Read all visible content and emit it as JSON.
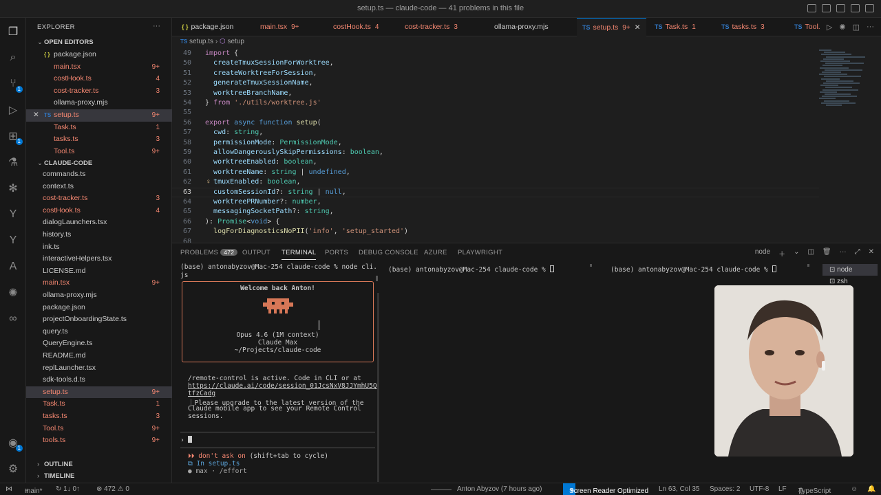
{
  "window": {
    "title": "setup.ts — claude-code — 41 problems in this file"
  },
  "activity": [
    {
      "name": "files-icon",
      "glyph": "❐"
    },
    {
      "name": "search-icon",
      "glyph": "⌕"
    },
    {
      "name": "source-control-icon",
      "glyph": "⑂",
      "badge": "1"
    },
    {
      "name": "run-debug-icon",
      "glyph": "▷"
    },
    {
      "name": "extensions-icon",
      "glyph": "⊞",
      "badge": "1"
    },
    {
      "name": "testing-icon",
      "glyph": "⚗"
    },
    {
      "name": "openai-icon",
      "glyph": "✻"
    },
    {
      "name": "github-icon",
      "glyph": "Y"
    },
    {
      "name": "git-graph-icon",
      "glyph": "Y"
    },
    {
      "name": "anthropic-icon",
      "glyph": "A"
    },
    {
      "name": "chatgpt-icon",
      "glyph": "✺"
    },
    {
      "name": "infinity-icon",
      "glyph": "∞"
    },
    {
      "name": "accounts-icon",
      "glyph": "◉",
      "badge": "1"
    },
    {
      "name": "settings-gear-icon",
      "glyph": "⚙"
    }
  ],
  "sidebar": {
    "header": "EXPLORER",
    "more": "···",
    "open_editors_label": "OPEN EDITORS",
    "open_editors": [
      {
        "icon": "{ }",
        "name": "package.json",
        "count": "",
        "style": "c-json",
        "ico": "ico-json"
      },
      {
        "icon": "",
        "name": "main.tsx",
        "count": "9+",
        "style": "c-err",
        "ico": "ico-react"
      },
      {
        "icon": "",
        "name": "costHook.ts",
        "count": "4",
        "style": "c-err",
        "ico": "ico-ts"
      },
      {
        "icon": "",
        "name": "cost-tracker.ts",
        "count": "3",
        "style": "c-err",
        "ico": "ico-ts"
      },
      {
        "icon": "",
        "name": "ollama-proxy.mjs",
        "count": "",
        "style": "c-plain",
        "ico": "ico-json"
      },
      {
        "icon": "TS",
        "name": "setup.ts",
        "count": "9+",
        "style": "c-err",
        "ico": "ico-ts",
        "selected": true,
        "close": "✕"
      },
      {
        "icon": "",
        "name": "Task.ts",
        "count": "1",
        "style": "c-err",
        "ico": "ico-ts"
      },
      {
        "icon": "",
        "name": "tasks.ts",
        "count": "3",
        "style": "c-err",
        "ico": "ico-ts"
      },
      {
        "icon": "",
        "name": "Tool.ts",
        "count": "9+",
        "style": "c-err",
        "ico": "ico-ts"
      }
    ],
    "project_label": "CLAUDE-CODE",
    "files": [
      {
        "name": "commands.ts",
        "count": "",
        "style": "c-plain"
      },
      {
        "name": "context.ts",
        "count": "",
        "style": "c-plain"
      },
      {
        "name": "cost-tracker.ts",
        "count": "3",
        "style": "c-err"
      },
      {
        "name": "costHook.ts",
        "count": "4",
        "style": "c-err"
      },
      {
        "name": "dialogLaunchers.tsx",
        "count": "",
        "style": "c-plain"
      },
      {
        "name": "history.ts",
        "count": "",
        "style": "c-plain"
      },
      {
        "name": "ink.ts",
        "count": "",
        "style": "c-plain"
      },
      {
        "name": "interactiveHelpers.tsx",
        "count": "",
        "style": "c-plain"
      },
      {
        "name": "LICENSE.md",
        "count": "",
        "style": "c-plain"
      },
      {
        "name": "main.tsx",
        "count": "9+",
        "style": "c-err"
      },
      {
        "name": "ollama-proxy.mjs",
        "count": "",
        "style": "c-plain"
      },
      {
        "name": "package.json",
        "count": "",
        "style": "c-plain"
      },
      {
        "name": "projectOnboardingState.ts",
        "count": "",
        "style": "c-plain"
      },
      {
        "name": "query.ts",
        "count": "",
        "style": "c-plain"
      },
      {
        "name": "QueryEngine.ts",
        "count": "",
        "style": "c-plain"
      },
      {
        "name": "README.md",
        "count": "",
        "style": "c-plain"
      },
      {
        "name": "replLauncher.tsx",
        "count": "",
        "style": "c-plain"
      },
      {
        "name": "sdk-tools.d.ts",
        "count": "",
        "style": "c-plain"
      },
      {
        "name": "setup.ts",
        "count": "9+",
        "style": "c-err",
        "selected": true
      },
      {
        "name": "Task.ts",
        "count": "1",
        "style": "c-err"
      },
      {
        "name": "tasks.ts",
        "count": "3",
        "style": "c-err"
      },
      {
        "name": "Tool.ts",
        "count": "9+",
        "style": "c-err"
      },
      {
        "name": "tools.ts",
        "count": "9+",
        "style": "c-err"
      }
    ],
    "outline_label": "OUTLINE",
    "timeline_label": "TIMELINE"
  },
  "tabs": [
    {
      "label": "package.json",
      "count": "",
      "prefix": "{ }",
      "style": "c-plain"
    },
    {
      "label": "main.tsx",
      "count": "9+",
      "prefix": "",
      "style": "c-err"
    },
    {
      "label": "costHook.ts",
      "count": "4",
      "prefix": "",
      "style": "c-err"
    },
    {
      "label": "cost-tracker.ts",
      "count": "3",
      "prefix": "",
      "style": "c-err"
    },
    {
      "label": "ollama-proxy.mjs",
      "count": "",
      "prefix": "",
      "style": "c-plain"
    },
    {
      "label": "setup.ts",
      "count": "9+",
      "prefix": "TS",
      "style": "c-err",
      "active": true,
      "close": "✕"
    },
    {
      "label": "Task.ts",
      "count": "1",
      "prefix": "TS",
      "style": "c-err"
    },
    {
      "label": "tasks.ts",
      "count": "3",
      "prefix": "TS",
      "style": "c-err"
    },
    {
      "label": "Tool.",
      "count": "",
      "prefix": "TS",
      "style": "c-err"
    }
  ],
  "breadcrumb": {
    "file": "setup.ts",
    "sep": "›",
    "symbol": "setup"
  },
  "editor": {
    "current_line": "63",
    "lines": [
      {
        "n": "49",
        "html": "<span class='k'>import</span> <span class='p'>{</span>"
      },
      {
        "n": "50",
        "html": "  <span class='v'>createTmuxSessionForWorktree</span>,"
      },
      {
        "n": "51",
        "html": "  <span class='v'>createWorktreeForSession</span>,"
      },
      {
        "n": "52",
        "html": "  <span class='v'>generateTmuxSessionName</span>,"
      },
      {
        "n": "53",
        "html": "  <span class='v'>worktreeBranchName</span>,"
      },
      {
        "n": "54",
        "html": "<span class='p'>}</span> <span class='k'>from</span> <span class='s'>'./utils/worktree.js'</span>"
      },
      {
        "n": "55",
        "html": ""
      },
      {
        "n": "56",
        "html": "<span class='k'>export</span> <span class='kb'>async</span> <span class='kb'>function</span> <span class='f'>setup</span>("
      },
      {
        "n": "57",
        "html": "  <span class='v'>cwd</span>: <span class='t'>string</span>,"
      },
      {
        "n": "58",
        "html": "  <span class='v'>permissionMode</span>: <span class='t'>PermissionMode</span>,"
      },
      {
        "n": "59",
        "html": "  <span class='v'>allowDangerouslySkipPermissions</span>: <span class='t'>boolean</span>,"
      },
      {
        "n": "60",
        "html": "  <span class='v'>worktreeEnabled</span>: <span class='t'>boolean</span>,"
      },
      {
        "n": "61",
        "html": "  <span class='v'>worktreeName</span>: <span class='t'>string</span> | <span class='kb'>undefined</span>,"
      },
      {
        "n": "62",
        "html": "  <span class='v'>tmuxEnabled</span>: <span class='t'>boolean</span>,"
      },
      {
        "n": "63",
        "html": "  <span class='v'>customSessionId</span>?: <span class='t'>string</span> | <span class='kb'>null</span>,"
      },
      {
        "n": "64",
        "html": "  <span class='v'>worktreePRNumber</span>?: <span class='t'>number</span>,"
      },
      {
        "n": "65",
        "html": "  <span class='v'>messagingSocketPath</span>?: <span class='t'>string</span>,"
      },
      {
        "n": "66",
        "html": "): <span class='t'>Promise</span>&lt;<span class='kb'>void</span>&gt; {"
      },
      {
        "n": "67",
        "html": "  <span class='f'>logForDiagnosticsNoPII</span>(<span class='s'>'info'</span>, <span class='s'>'setup_started'</span>)"
      },
      {
        "n": "68",
        "html": ""
      }
    ]
  },
  "panel": {
    "tabs": [
      {
        "label": "PROBLEMS",
        "badge": "472"
      },
      {
        "label": "OUTPUT"
      },
      {
        "label": "TERMINAL",
        "active": true
      },
      {
        "label": "PORTS"
      },
      {
        "label": "DEBUG CONSOLE"
      },
      {
        "label": "AZURE"
      },
      {
        "label": "PLAYWRIGHT"
      }
    ],
    "shell_label": "node",
    "terminal1": {
      "prompt_line1": "(base) antonabyzov@Mac-254 claude-code % node cli.",
      "prompt_line2": "js",
      "welcome": "Welcome back Anton!",
      "model": "Opus 4.6 (1M context)",
      "plan": "Claude Max",
      "path": "~/Projects/claude-code",
      "remote1": "/remote-control is active. Code in CLI or at",
      "remote_url1": "https://claude.ai/code/session_01JcsNxV8JJYmhU5Q",
      "remote_url2": "tfzCadg",
      "upgrade1": "⎿Please upgrade to the latest version of the",
      "upgrade2": "Claude mobile app to see your Remote Control",
      "upgrade3": "sessions.",
      "input_prompt": "›",
      "mode": "⏵⏵ don't ask on",
      "mode_hint": " (shift+tab to cycle)",
      "file_ctx": "⧉ In setup.ts",
      "effort": "● max · /effort"
    },
    "terminal2": {
      "prompt": "(base) antonabyzov@Mac-254 claude-code % "
    },
    "terminal3": {
      "prompt": "(base) antonabyzov@Mac-254 claude-code % "
    },
    "terminal_list": [
      "node",
      "zsh"
    ]
  },
  "status": {
    "branch": "main*",
    "sync": "↻ 1↓ 0↑",
    "problems": "⊗ 472 ⚠ 0",
    "blame": "Anton Abyzov (7 hours ago)",
    "screen_reader": "Screen Reader Optimized",
    "position": "Ln 63, Col 35",
    "spaces": "Spaces: 2",
    "encoding": "UTF-8",
    "eol": "LF",
    "language": "TypeScript",
    "colors": {
      "accent": "#0078d4",
      "error": "#f48771",
      "claude": "#d77757"
    }
  }
}
